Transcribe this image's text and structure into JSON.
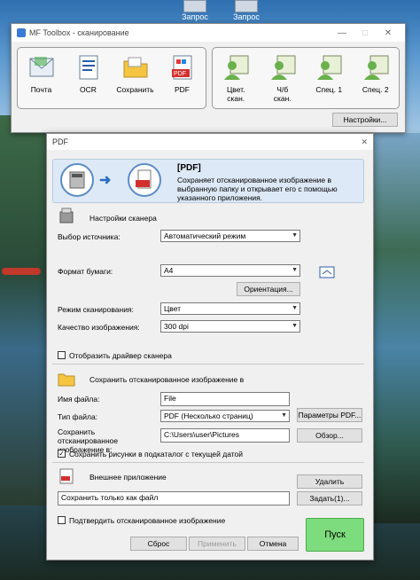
{
  "desktop": {
    "icons": [
      {
        "label": "Запрос"
      },
      {
        "label": "Запрос"
      }
    ]
  },
  "toolbox": {
    "title": "MF Toolbox - сканирование",
    "controls": {
      "minimize": "—",
      "maximize": "□",
      "close": "✕"
    },
    "left_tools": [
      {
        "label": "Почта",
        "icon": "mail-icon"
      },
      {
        "label": "OCR",
        "icon": "ocr-icon"
      },
      {
        "label": "Сохранить",
        "icon": "folder-icon"
      },
      {
        "label": "PDF",
        "icon": "pdf-icon"
      }
    ],
    "right_tools": [
      {
        "label": "Цвет.\nскан.",
        "icon": "user-scan-icon"
      },
      {
        "label": "Ч/б\nскан.",
        "icon": "user-scan-icon"
      },
      {
        "label": "Спец. 1",
        "icon": "user-scan-icon"
      },
      {
        "label": "Спец. 2",
        "icon": "user-scan-icon"
      }
    ],
    "settings_label": "Настройки..."
  },
  "dialog": {
    "title": "PDF",
    "close": "✕",
    "banner": {
      "title": "[PDF]",
      "description": "Сохраняет отсканированное изображение в выбранную папку и открывает его с помощью указанного приложения."
    },
    "scanner_settings": {
      "heading": "Настройки сканера",
      "source_label": "Выбор источника:",
      "source_value": "Автоматический режим",
      "paper_label": "Формат бумаги:",
      "paper_value": "A4",
      "orientation_label": "Ориентация...",
      "mode_label": "Режим сканирования:",
      "mode_value": "Цвет",
      "quality_label": "Качество изображения:",
      "quality_value": "300 dpi",
      "driver_checkbox": "Отобразить драйвер сканера",
      "driver_checked": false
    },
    "save_settings": {
      "heading": "Сохранить отсканированное изображение в",
      "filename_label": "Имя файла:",
      "filename_value": "File",
      "filetype_label": "Тип файла:",
      "filetype_value": "PDF (Несколько страниц)",
      "pdf_params_label": "Параметры PDF...",
      "path_label": "Сохранить отсканированное изображение в:",
      "path_value": "C:\\Users\\user\\Pictures",
      "browse_label": "Обзор...",
      "subfolder_checkbox": "Сохранить рисунки в подкаталог с текущей датой",
      "subfolder_checked": true
    },
    "external_app": {
      "heading": "Внешнее приложение",
      "delete_label": "Удалить",
      "app_value": "Сохранить только как файл",
      "set_label": "Задать(1)..."
    },
    "confirm_checkbox": "Подтвердить отсканированное изображение",
    "confirm_checked": false,
    "buttons": {
      "reset": "Сброс",
      "apply": "Применить",
      "cancel": "Отмена",
      "scan": "Пуск"
    }
  }
}
